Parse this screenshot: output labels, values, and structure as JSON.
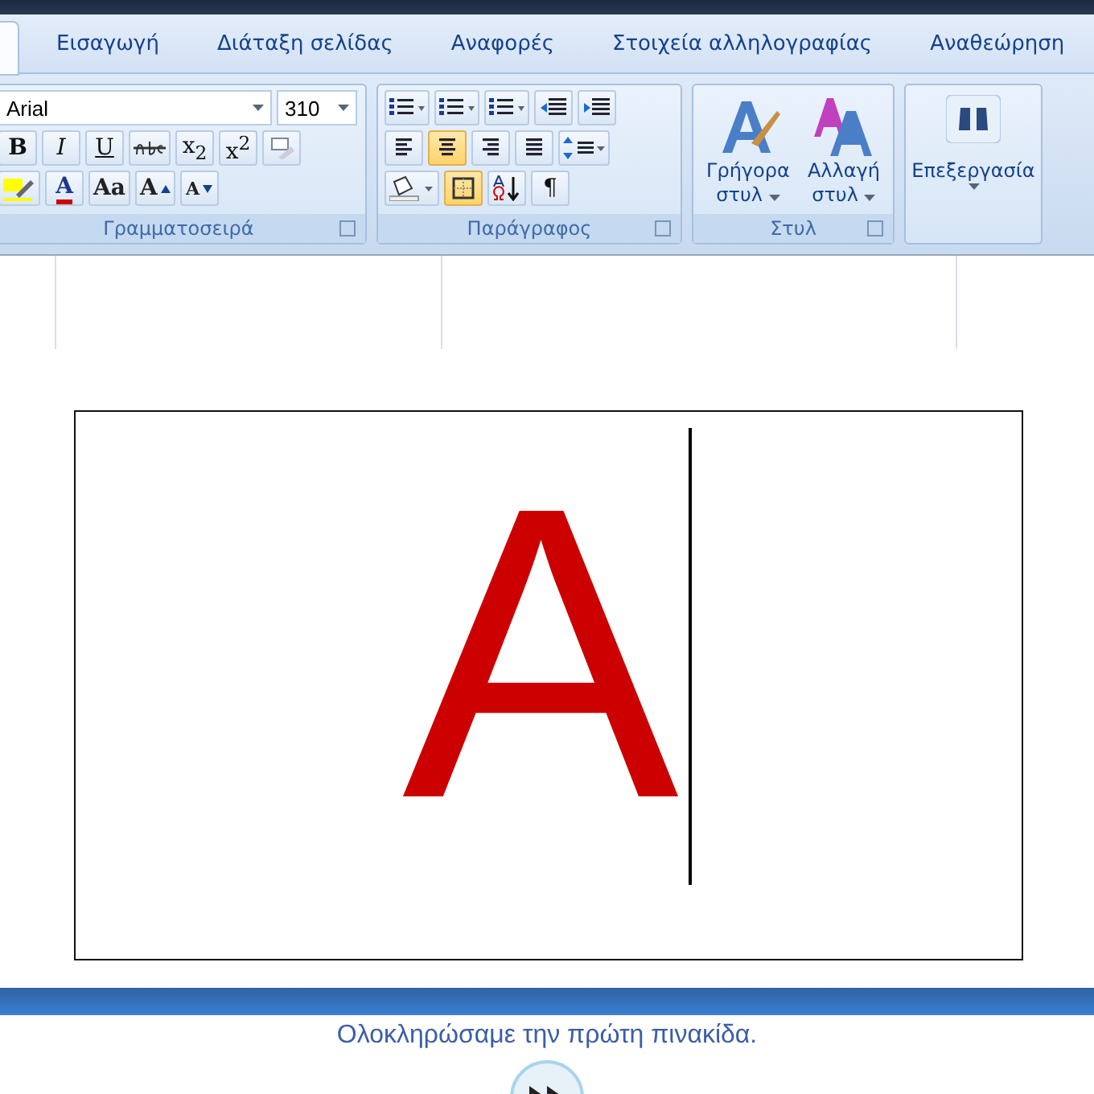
{
  "tabs": [
    {
      "label": "Εισαγωγή",
      "selected": false
    },
    {
      "label": "Διάταξη σελίδας",
      "selected": false
    },
    {
      "label": "Αναφορές",
      "selected": false
    },
    {
      "label": "Στοιχεία αλληλογραφίας",
      "selected": false
    },
    {
      "label": "Αναθεώρηση",
      "selected": false
    }
  ],
  "font_group": {
    "font_name": "Arial",
    "font_size": "310",
    "label": "Γραμματοσειρά",
    "format_buttons": [
      {
        "label": "B",
        "kind": "bold"
      },
      {
        "label": "I",
        "kind": "italic"
      },
      {
        "label": "U",
        "kind": "underline"
      },
      {
        "label": "x$_{2}$",
        "kind": "plain"
      },
      {
        "label": "x$^{2}$",
        "kind": "plain"
      }
    ],
    "size_buttons": [
      {
        "label": "A",
        "kind": "color"
      },
      {
        "label": "Aa",
        "kind": "plain"
      },
      {
        "label": "A",
        "kind": "grow"
      },
      {
        "label": "A",
        "kind": "shrink"
      }
    ]
  },
  "paragraph_group": {
    "label": "Παράγραφος",
    "align_buttons": [
      {
        "kind": "left",
        "selected": false
      },
      {
        "kind": "center",
        "selected": true
      },
      {
        "kind": "right",
        "selected": false
      },
      {
        "kind": "justify",
        "selected": false
      }
    ],
    "borders_active": true,
    "pilcrow": "¶"
  },
  "styles_group": {
    "label": "Στυλ",
    "buttons": [
      {
        "line1": "Γρήγορα",
        "line2": "στυλ",
        "kind": "quick"
      },
      {
        "line1": "Αλλαγή",
        "line2": "στυλ",
        "kind": "change"
      }
    ]
  },
  "editing_group": {
    "label": "Επεξεργασία"
  },
  "document": {
    "text": "A",
    "color": "#cc0000"
  },
  "caption": "Ολοκληρώσαμε την πρώτη πινακίδα."
}
